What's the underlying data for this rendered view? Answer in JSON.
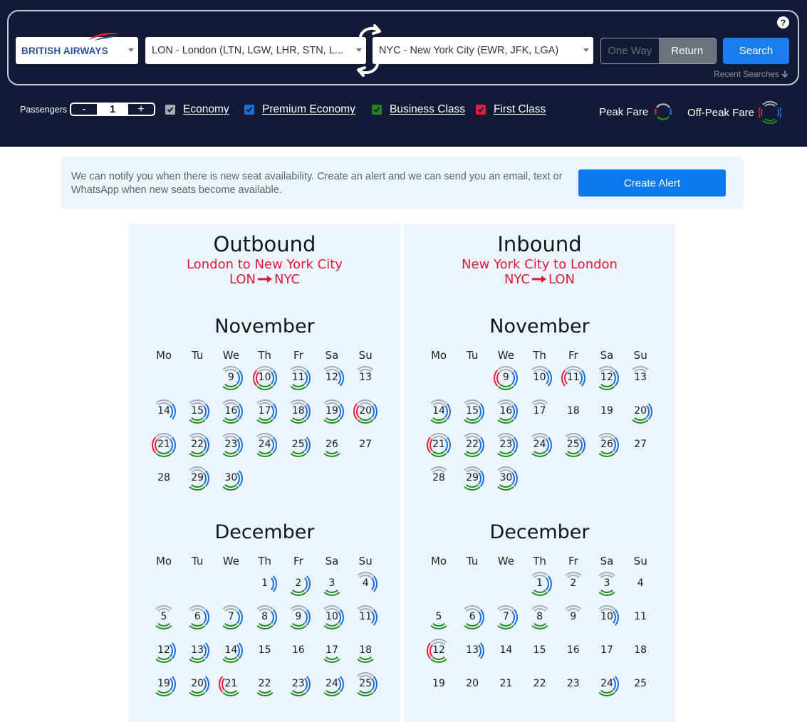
{
  "header": {
    "airline": "BRITISH AIRWAYS",
    "origin": "LON - London (LTN, LGW, LHR, STN, L...",
    "destination": "NYC - New York City (EWR, JFK, LGA)",
    "one_way_label": "One Way",
    "return_label": "Return",
    "search_label": "Search",
    "help_label": "?",
    "recent_searches_label": "Recent Searches"
  },
  "options": {
    "passengers_label": "Passengers",
    "passengers_value": "1",
    "minus": "-",
    "plus": "+",
    "cabins": [
      {
        "label": "Economy",
        "accel": "E",
        "color": "#a9abb3"
      },
      {
        "label": "Premium Economy",
        "accel": "P",
        "color": "#1a6ed8"
      },
      {
        "label": "Business Class",
        "accel": "B",
        "color": "#1e8a1e"
      },
      {
        "label": "First Class",
        "accel": "F",
        "color": "#e41e3a"
      }
    ],
    "peak_label": "Peak Fare",
    "offpeak_label": "Off-Peak Fare"
  },
  "alert": {
    "text": "We can notify you when there is new seat availability. Create an alert and we can send you an email, text or WhatsApp when new seats become available.",
    "button": "Create Alert"
  },
  "colors": {
    "economy": "#a9abb3",
    "premium": "#1a6ed8",
    "business": "#1e8a1e",
    "first": "#e41e3a"
  },
  "weekdays": [
    "Mo",
    "Tu",
    "We",
    "Th",
    "Fr",
    "Sa",
    "Su"
  ],
  "panels": [
    {
      "title": "Outbound",
      "route": "London to New York City",
      "from": "LON",
      "to": "NYC",
      "months": [
        {
          "name": "November",
          "first_weekday": 2,
          "days": [
            {
              "d": 9,
              "e": 1,
              "p": 1,
              "b": 1,
              "f": 0
            },
            {
              "d": 10,
              "e": 1,
              "p": 1,
              "b": 1,
              "f": 1
            },
            {
              "d": 11,
              "e": 1,
              "p": 1,
              "b": 1,
              "f": 0
            },
            {
              "d": 12,
              "e": 1,
              "p": 1,
              "b": 0,
              "f": 0
            },
            {
              "d": 13,
              "e": 1,
              "p": 0,
              "b": 0,
              "f": 0
            },
            {
              "d": 14,
              "e": 1,
              "p": 1,
              "b": 0,
              "f": 0
            },
            {
              "d": 15,
              "e": 1,
              "p": 1,
              "b": 1,
              "f": 0
            },
            {
              "d": 16,
              "e": 1,
              "p": 1,
              "b": 1,
              "f": 0
            },
            {
              "d": 17,
              "e": 1,
              "p": 1,
              "b": 1,
              "f": 0
            },
            {
              "d": 18,
              "e": 1,
              "p": 1,
              "b": 1,
              "f": 0
            },
            {
              "d": 19,
              "e": 1,
              "p": 1,
              "b": 1,
              "f": 0
            },
            {
              "d": 20,
              "e": 1,
              "p": 1,
              "b": 1,
              "f": 1
            },
            {
              "d": 21,
              "e": 1,
              "p": 1,
              "b": 1,
              "f": 1
            },
            {
              "d": 22,
              "e": 1,
              "p": 1,
              "b": 1,
              "f": 0
            },
            {
              "d": 23,
              "e": 1,
              "p": 1,
              "b": 1,
              "f": 0
            },
            {
              "d": 24,
              "e": 1,
              "p": 1,
              "b": 1,
              "f": 0
            },
            {
              "d": 25,
              "e": 0,
              "p": 1,
              "b": 1,
              "f": 0
            },
            {
              "d": 26,
              "e": 0,
              "p": 0,
              "b": 1,
              "f": 0
            },
            {
              "d": 27,
              "e": 0,
              "p": 0,
              "b": 0,
              "f": 0
            },
            {
              "d": 28,
              "e": 0,
              "p": 0,
              "b": 0,
              "f": 0
            },
            {
              "d": 29,
              "e": 1,
              "p": 1,
              "b": 1,
              "f": 0
            },
            {
              "d": 30,
              "e": 0,
              "p": 1,
              "b": 1,
              "f": 0
            }
          ]
        },
        {
          "name": "December",
          "first_weekday": 3,
          "days": [
            {
              "d": 1,
              "e": 0,
              "p": 1,
              "b": 0,
              "f": 0
            },
            {
              "d": 2,
              "e": 0,
              "p": 1,
              "b": 1,
              "f": 0
            },
            {
              "d": 3,
              "e": 0,
              "p": 0,
              "b": 1,
              "f": 0
            },
            {
              "d": 4,
              "e": 1,
              "p": 1,
              "b": 0,
              "f": 0
            },
            {
              "d": 5,
              "e": 1,
              "p": 0,
              "b": 1,
              "f": 0
            },
            {
              "d": 6,
              "e": 1,
              "p": 1,
              "b": 1,
              "f": 0
            },
            {
              "d": 7,
              "e": 1,
              "p": 1,
              "b": 1,
              "f": 0
            },
            {
              "d": 8,
              "e": 1,
              "p": 1,
              "b": 1,
              "f": 0
            },
            {
              "d": 9,
              "e": 1,
              "p": 1,
              "b": 1,
              "f": 0
            },
            {
              "d": 10,
              "e": 1,
              "p": 1,
              "b": 1,
              "f": 0
            },
            {
              "d": 11,
              "e": 1,
              "p": 1,
              "b": 0,
              "f": 0
            },
            {
              "d": 12,
              "e": 0,
              "p": 1,
              "b": 1,
              "f": 0
            },
            {
              "d": 13,
              "e": 0,
              "p": 1,
              "b": 1,
              "f": 0
            },
            {
              "d": 14,
              "e": 0,
              "p": 1,
              "b": 1,
              "f": 0
            },
            {
              "d": 15,
              "e": 0,
              "p": 0,
              "b": 0,
              "f": 0
            },
            {
              "d": 16,
              "e": 0,
              "p": 0,
              "b": 0,
              "f": 0
            },
            {
              "d": 17,
              "e": 0,
              "p": 0,
              "b": 1,
              "f": 0
            },
            {
              "d": 18,
              "e": 0,
              "p": 0,
              "b": 1,
              "f": 0
            },
            {
              "d": 19,
              "e": 0,
              "p": 1,
              "b": 1,
              "f": 0
            },
            {
              "d": 20,
              "e": 0,
              "p": 1,
              "b": 1,
              "f": 0
            },
            {
              "d": 21,
              "e": 0,
              "p": 0,
              "b": 1,
              "f": 1
            },
            {
              "d": 22,
              "e": 0,
              "p": 0,
              "b": 1,
              "f": 0
            },
            {
              "d": 23,
              "e": 0,
              "p": 1,
              "b": 1,
              "f": 0
            },
            {
              "d": 24,
              "e": 0,
              "p": 1,
              "b": 1,
              "f": 0
            },
            {
              "d": 25,
              "e": 1,
              "p": 1,
              "b": 1,
              "f": 0
            }
          ]
        }
      ]
    },
    {
      "title": "Inbound",
      "route": "New York City to London",
      "from": "NYC",
      "to": "LON",
      "months": [
        {
          "name": "November",
          "first_weekday": 2,
          "days": [
            {
              "d": 9,
              "e": 1,
              "p": 1,
              "b": 1,
              "f": 1
            },
            {
              "d": 10,
              "e": 1,
              "p": 1,
              "b": 0,
              "f": 0
            },
            {
              "d": 11,
              "e": 1,
              "p": 1,
              "b": 0,
              "f": 1
            },
            {
              "d": 12,
              "e": 1,
              "p": 1,
              "b": 1,
              "f": 0
            },
            {
              "d": 13,
              "e": 1,
              "p": 0,
              "b": 0,
              "f": 0
            },
            {
              "d": 14,
              "e": 1,
              "p": 1,
              "b": 1,
              "f": 0
            },
            {
              "d": 15,
              "e": 1,
              "p": 1,
              "b": 1,
              "f": 0
            },
            {
              "d": 16,
              "e": 1,
              "p": 1,
              "b": 1,
              "f": 0
            },
            {
              "d": 17,
              "e": 1,
              "p": 0,
              "b": 0,
              "f": 0
            },
            {
              "d": 18,
              "e": 0,
              "p": 0,
              "b": 0,
              "f": 0
            },
            {
              "d": 19,
              "e": 0,
              "p": 0,
              "b": 0,
              "f": 0
            },
            {
              "d": 20,
              "e": 0,
              "p": 1,
              "b": 1,
              "f": 0
            },
            {
              "d": 21,
              "e": 1,
              "p": 1,
              "b": 1,
              "f": 1
            },
            {
              "d": 22,
              "e": 1,
              "p": 1,
              "b": 1,
              "f": 0
            },
            {
              "d": 23,
              "e": 1,
              "p": 1,
              "b": 1,
              "f": 0
            },
            {
              "d": 24,
              "e": 1,
              "p": 1,
              "b": 1,
              "f": 0
            },
            {
              "d": 25,
              "e": 1,
              "p": 1,
              "b": 1,
              "f": 0
            },
            {
              "d": 26,
              "e": 1,
              "p": 1,
              "b": 1,
              "f": 0
            },
            {
              "d": 27,
              "e": 0,
              "p": 0,
              "b": 0,
              "f": 0
            },
            {
              "d": 28,
              "e": 1,
              "p": 0,
              "b": 0,
              "f": 0
            },
            {
              "d": 29,
              "e": 1,
              "p": 1,
              "b": 1,
              "f": 0
            },
            {
              "d": 30,
              "e": 1,
              "p": 1,
              "b": 1,
              "f": 0
            }
          ]
        },
        {
          "name": "December",
          "first_weekday": 3,
          "days": [
            {
              "d": 1,
              "e": 1,
              "p": 1,
              "b": 1,
              "f": 0
            },
            {
              "d": 2,
              "e": 1,
              "p": 0,
              "b": 0,
              "f": 0
            },
            {
              "d": 3,
              "e": 1,
              "p": 0,
              "b": 1,
              "f": 0
            },
            {
              "d": 4,
              "e": 0,
              "p": 0,
              "b": 0,
              "f": 0
            },
            {
              "d": 5,
              "e": 0,
              "p": 0,
              "b": 1,
              "f": 0
            },
            {
              "d": 6,
              "e": 1,
              "p": 1,
              "b": 1,
              "f": 0
            },
            {
              "d": 7,
              "e": 1,
              "p": 1,
              "b": 1,
              "f": 0
            },
            {
              "d": 8,
              "e": 1,
              "p": 0,
              "b": 1,
              "f": 0
            },
            {
              "d": 9,
              "e": 1,
              "p": 0,
              "b": 0,
              "f": 0
            },
            {
              "d": 10,
              "e": 1,
              "p": 1,
              "b": 0,
              "f": 0
            },
            {
              "d": 11,
              "e": 0,
              "p": 0,
              "b": 0,
              "f": 0
            },
            {
              "d": 12,
              "e": 1,
              "p": 0,
              "b": 1,
              "f": 1
            },
            {
              "d": 13,
              "e": 0,
              "p": 1,
              "b": 0,
              "f": 0
            },
            {
              "d": 14,
              "e": 0,
              "p": 0,
              "b": 0,
              "f": 0
            },
            {
              "d": 15,
              "e": 0,
              "p": 0,
              "b": 0,
              "f": 0
            },
            {
              "d": 16,
              "e": 0,
              "p": 0,
              "b": 0,
              "f": 0
            },
            {
              "d": 17,
              "e": 0,
              "p": 0,
              "b": 0,
              "f": 0
            },
            {
              "d": 18,
              "e": 0,
              "p": 0,
              "b": 0,
              "f": 0
            },
            {
              "d": 19,
              "e": 0,
              "p": 0,
              "b": 0,
              "f": 0
            },
            {
              "d": 20,
              "e": 0,
              "p": 0,
              "b": 0,
              "f": 0
            },
            {
              "d": 21,
              "e": 0,
              "p": 0,
              "b": 0,
              "f": 0
            },
            {
              "d": 22,
              "e": 0,
              "p": 0,
              "b": 0,
              "f": 0
            },
            {
              "d": 23,
              "e": 0,
              "p": 0,
              "b": 0,
              "f": 0
            },
            {
              "d": 24,
              "e": 0,
              "p": 1,
              "b": 1,
              "f": 0
            },
            {
              "d": 25,
              "e": 0,
              "p": 0,
              "b": 0,
              "f": 0
            }
          ]
        }
      ]
    }
  ]
}
